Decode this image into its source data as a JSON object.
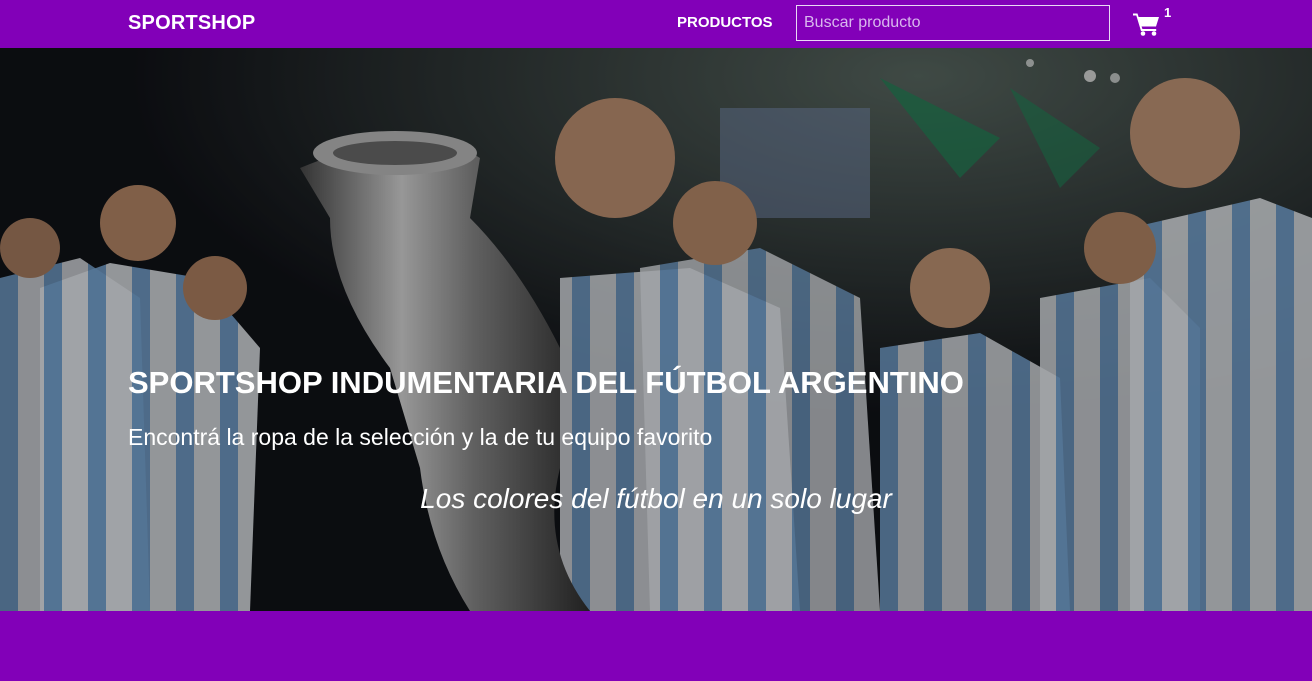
{
  "header": {
    "brand": "SPORTSHOP",
    "nav_products": "PRODUCTOS",
    "search_placeholder": "Buscar producto",
    "search_value": "",
    "cart_icon": "shopping-cart-icon",
    "cart_count": "1"
  },
  "hero": {
    "title": "SPORTSHOP INDUMENTARIA DEL FÚTBOL ARGENTINO",
    "subtitle": "Encontrá la ropa de la selección y la de tu equipo favorito",
    "tagline": "Los colores del fútbol en un solo lugar"
  },
  "colors": {
    "brand_purple": "#8200b8",
    "text_white": "#ffffff",
    "jersey_blue": "#75aadb"
  }
}
